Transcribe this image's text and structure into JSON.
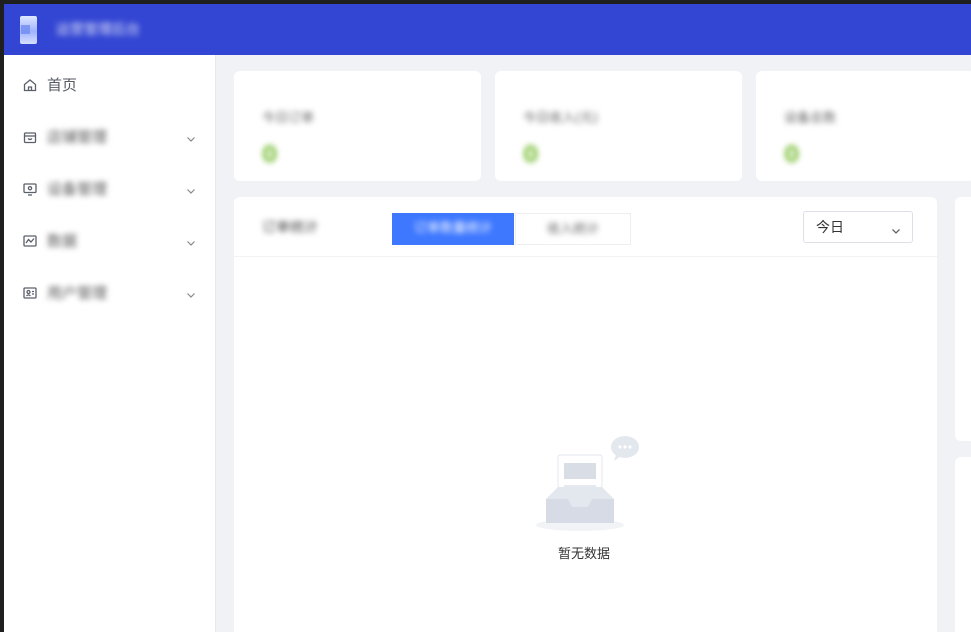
{
  "header": {
    "app_title": "运营管理后台"
  },
  "sidebar": {
    "items": [
      {
        "label": "首页",
        "icon": "home-icon",
        "expandable": false
      },
      {
        "label": "店铺管理",
        "icon": "shop-icon",
        "expandable": true
      },
      {
        "label": "设备管理",
        "icon": "monitor-icon",
        "expandable": true
      },
      {
        "label": "数据",
        "icon": "chart-icon",
        "expandable": true
      },
      {
        "label": "用户管理",
        "icon": "user-card-icon",
        "expandable": true
      }
    ]
  },
  "stats": [
    {
      "label": "今日订单",
      "value": "0"
    },
    {
      "label": "今日收入(元)",
      "value": "0"
    },
    {
      "label": "设备总数",
      "value": "0"
    }
  ],
  "panel": {
    "title": "订单统计",
    "tabs": [
      {
        "label": "订单数量统计",
        "active": true
      },
      {
        "label": "收入统计",
        "active": false
      }
    ],
    "range_select": {
      "value": "今日"
    },
    "empty_text": "暂无数据"
  },
  "colors": {
    "header": "#3346d3",
    "active_tab": "#3e78ff",
    "stat_value": "#7cbf3c",
    "background": "#f0f2f5"
  }
}
